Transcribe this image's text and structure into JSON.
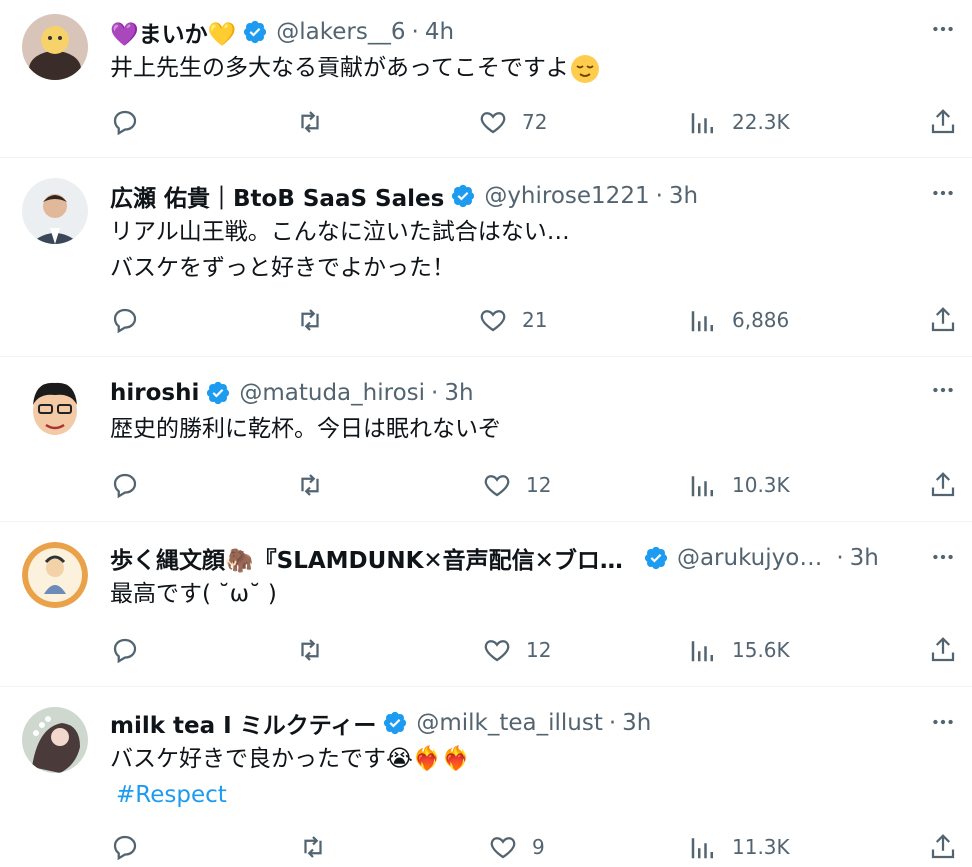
{
  "tweets": [
    {
      "name": "💜まいか💛",
      "handle": "@lakers__6",
      "time": "4h",
      "lines": [
        "井上先生の多大なる貢献があってこそですよ"
      ],
      "trailing_emoji": "relieved-face",
      "likes": "72",
      "views": "22.3K"
    },
    {
      "name": "広瀬 佑貴｜BtoB SaaS Sales",
      "handle": "@yhirose1221",
      "time": "3h",
      "lines": [
        "リアル山王戦。こんなに泣いた試合はない…",
        "バスケをずっと好きでよかった！"
      ],
      "likes": "21",
      "views": "6,886"
    },
    {
      "name": "hiroshi",
      "handle": "@matuda_hirosi",
      "time": "3h",
      "lines": [
        "歴史的勝利に乾杯。今日は眠れないぞ"
      ],
      "likes": "12",
      "views": "10.3K"
    },
    {
      "name": "歩く縄文顔🦣『SLAMDUNK✕音声配信✕ブロ…",
      "handle": "@arukujyo…",
      "time": "3h",
      "lines": [
        "最高です( ˘ω˘ )"
      ],
      "likes": "12",
      "views": "15.6K"
    },
    {
      "name": "milk tea I ミルクティー",
      "handle": "@milk_tea_illust",
      "time": "3h",
      "lines": [
        "バスケ好きで良かったです😭❤️‍🔥❤️‍🔥"
      ],
      "hashtag": "#Respect",
      "likes": "9",
      "views": "11.3K"
    }
  ],
  "separator": "·",
  "colors": {
    "text": "#0f1419",
    "secondary": "#536471",
    "verified": "#1d9bf0",
    "link": "#1d9bf0",
    "divider": "#eff3f4"
  },
  "icons": [
    "reply-icon",
    "retweet-icon",
    "like-icon",
    "views-icon",
    "share-icon",
    "more-icon",
    "verified-badge-icon"
  ]
}
